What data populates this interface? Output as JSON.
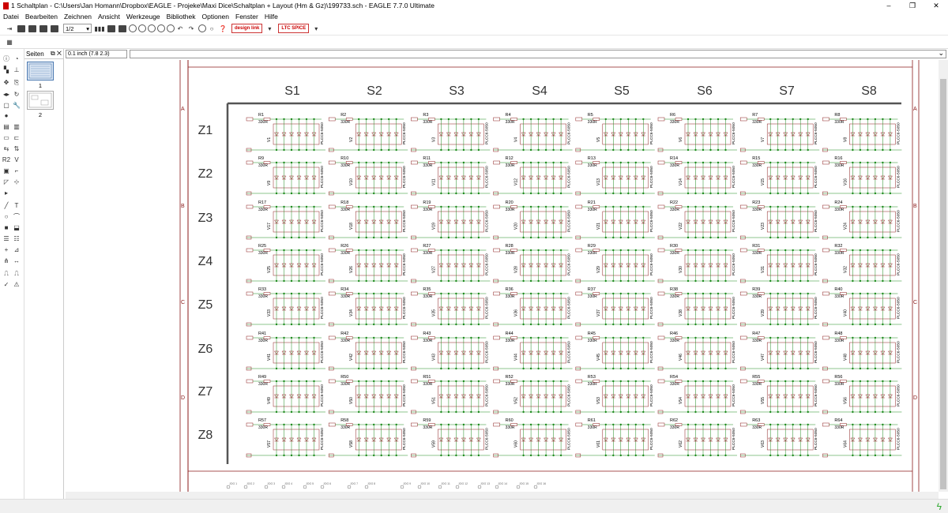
{
  "window": {
    "title": "1 Schaltplan - C:\\Users\\Jan Homann\\Dropbox\\EAGLE - Projeke\\Maxi Dice\\Schaltplan + Layout (Hm  & Gz)\\199733.sch - EAGLE 7.7.0 Ultimate",
    "controls": [
      "–",
      "❐",
      "✕"
    ]
  },
  "menu": [
    "Datei",
    "Bearbeiten",
    "Zeichnen",
    "Ansicht",
    "Werkzeuge",
    "Bibliothek",
    "Optionen",
    "Fenster",
    "Hilfe"
  ],
  "toolbar": {
    "zoom_select": "1/2",
    "logo1": "design link",
    "logo2": "LTC SPICE"
  },
  "pages_panel": {
    "tab_label": "Seiten",
    "pages": [
      "1",
      "2"
    ]
  },
  "command": {
    "coordinate": "0.1 inch (7.8 2.3)",
    "input": ""
  },
  "schematic": {
    "columns": [
      "S1",
      "S2",
      "S3",
      "S4",
      "S5",
      "S6",
      "S7",
      "S8"
    ],
    "rows": [
      "Z1",
      "Z2",
      "Z3",
      "Z4",
      "Z5",
      "Z6",
      "Z7",
      "Z8"
    ],
    "frame_letters": [
      "A",
      "B",
      "C",
      "D"
    ],
    "resistor_value": "330R",
    "package_label": "PLCC6-5050",
    "cell_label_prefix_r": "R",
    "cell_label_prefix_v": "V",
    "bottom_labels": [
      "JOG 1",
      "JOG 2",
      "JOG 3",
      "JOG 4",
      "JOG 5",
      "JOG 6",
      "JOG 7",
      "JOG 8",
      "JOG 9",
      "JOG 10",
      "JOG 11",
      "JOG 12",
      "JOG 13",
      "JOG 14",
      "JOG 15",
      "JOG 16"
    ],
    "colors": {
      "frame": "#8b1a1a",
      "net": "#1d8a1d",
      "part": "#8b1a1a",
      "bus": "#555555",
      "text": "#000000"
    }
  }
}
